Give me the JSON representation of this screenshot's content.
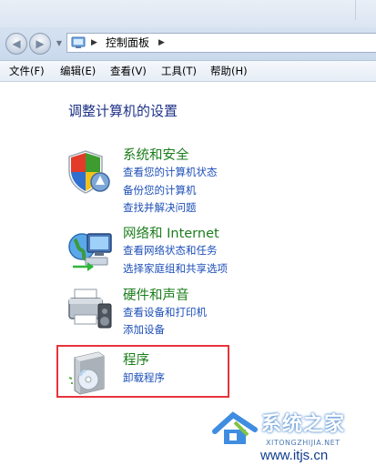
{
  "window": {
    "address_path": [
      "控制面板"
    ]
  },
  "menu": [
    {
      "label": "文件(F)"
    },
    {
      "label": "编辑(E)"
    },
    {
      "label": "查看(V)"
    },
    {
      "label": "工具(T)"
    },
    {
      "label": "帮助(H)"
    }
  ],
  "page_title": "调整计算机的设置",
  "categories": [
    {
      "title": "系统和安全",
      "icon": "shield-icon",
      "links": [
        "查看您的计算机状态",
        "备份您的计算机",
        "查找并解决问题"
      ]
    },
    {
      "title": "网络和 Internet",
      "icon": "network-globe-icon",
      "links": [
        "查看网络状态和任务",
        "选择家庭组和共享选项"
      ]
    },
    {
      "title": "硬件和声音",
      "icon": "printer-speaker-icon",
      "links": [
        "查看设备和打印机",
        "添加设备"
      ]
    },
    {
      "title": "程序",
      "icon": "programs-disc-icon",
      "links": [
        "卸载程序"
      ],
      "highlighted": true
    }
  ],
  "colors": {
    "category_title": "#1c7d1c",
    "link": "#1d4fb8",
    "page_title": "#1e3287",
    "highlight": "#e8333b"
  },
  "watermark": {
    "name": "系统之家",
    "pinyin": "XITONGZHIJIA.NET",
    "url": "www.itjs.cn"
  }
}
